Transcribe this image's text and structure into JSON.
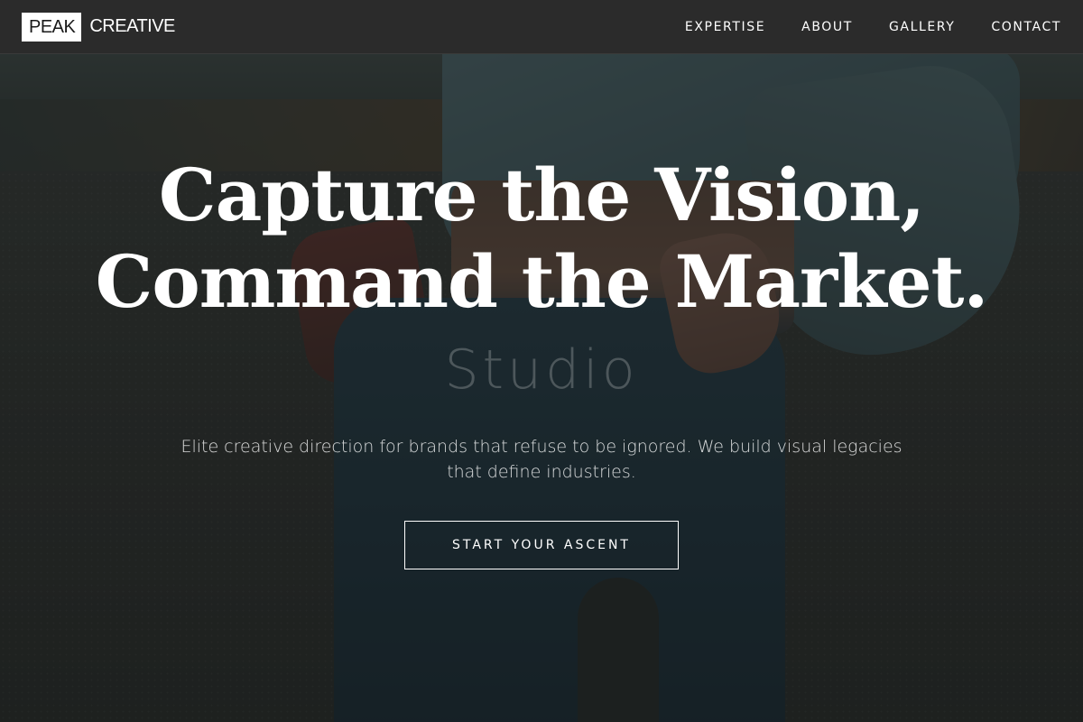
{
  "brand": {
    "logo_box": "PEAK",
    "logo_text": "CREATIVE"
  },
  "nav": {
    "items": [
      {
        "label": "EXPERTISE"
      },
      {
        "label": "ABOUT"
      },
      {
        "label": "GALLERY"
      },
      {
        "label": "CONTACT"
      }
    ]
  },
  "hero": {
    "ghost_text": "Studio",
    "title": "Capture the Vision, Command the Market.",
    "subtitle": "Elite creative direction for brands that refuse to be ignored. We build visual legacies that define industries.",
    "cta_label": "START YOUR ASCENT"
  },
  "colors": {
    "header_bg": "#2b2b2b",
    "text": "#ffffff",
    "logo_box_bg": "#ffffff",
    "logo_box_text": "#1a1a1a"
  }
}
